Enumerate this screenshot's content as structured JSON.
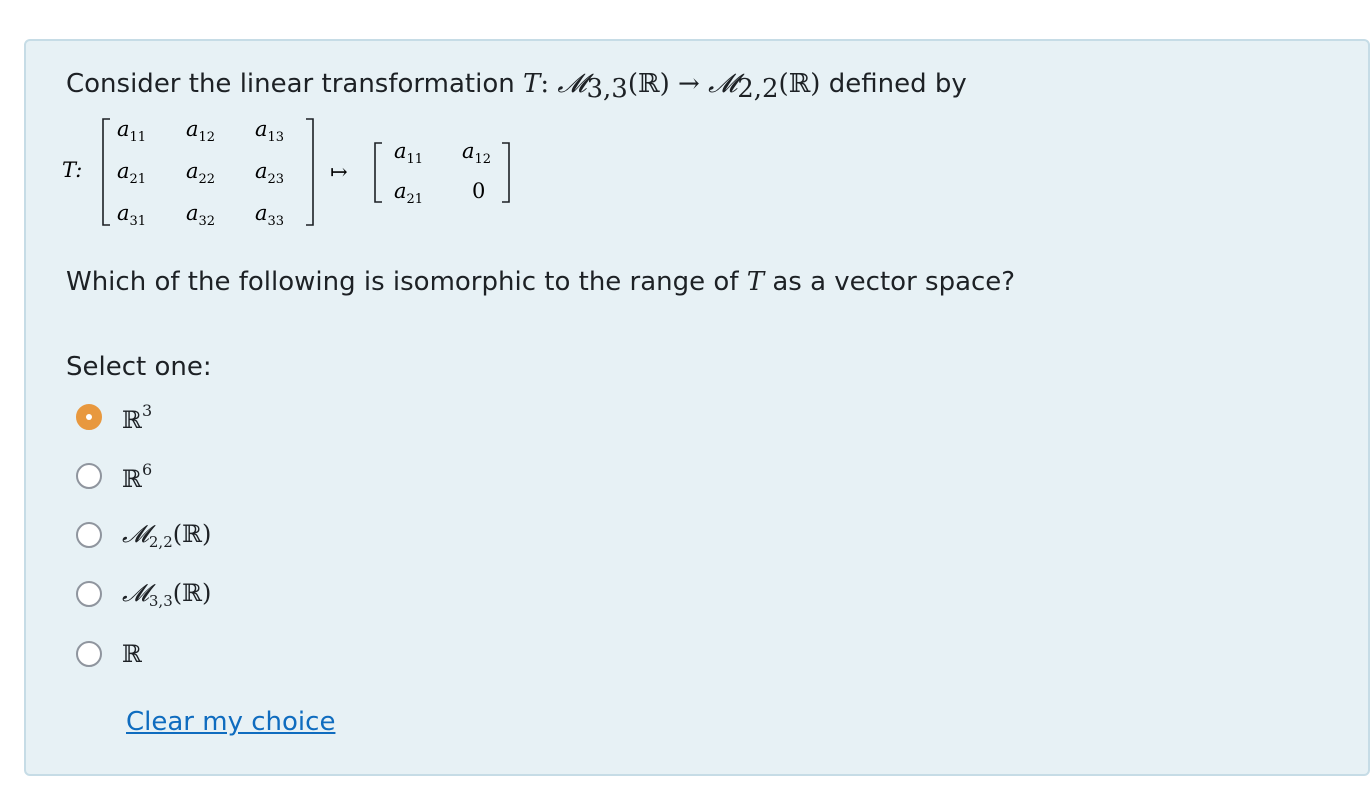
{
  "question": {
    "intro_prefix": "Consider the linear transformation ",
    "T_symbol": "T",
    "colon": ":",
    "domain_space": "𝓜",
    "domain_sub": "3,3",
    "domain_field": "(ℝ)",
    "arrow": "→",
    "codomain_space": "𝓜",
    "codomain_sub": "2,2",
    "codomain_field": "(ℝ)",
    "intro_suffix": " defined by",
    "mapping": {
      "T_label": "T:",
      "maps_to": "↦",
      "input_matrix": [
        [
          "a11",
          "a12",
          "a13"
        ],
        [
          "a21",
          "a22",
          "a23"
        ],
        [
          "a31",
          "a32",
          "a33"
        ]
      ],
      "output_matrix": [
        [
          "a11",
          "a12"
        ],
        [
          "a21",
          "0"
        ]
      ]
    },
    "prompt_prefix": "Which of the following is isomorphic to the range of ",
    "prompt_T": "T",
    "prompt_suffix": " as a vector space?"
  },
  "select_label": "Select one:",
  "options": [
    {
      "base": "ℝ",
      "sup": "3",
      "sub": "",
      "tail": "",
      "checked": true
    },
    {
      "base": "ℝ",
      "sup": "6",
      "sub": "",
      "tail": "",
      "checked": false
    },
    {
      "base": "𝓜",
      "sup": "",
      "sub": "2,2",
      "tail": "(ℝ)",
      "checked": false
    },
    {
      "base": "𝓜",
      "sup": "",
      "sub": "3,3",
      "tail": "(ℝ)",
      "checked": false
    },
    {
      "base": "ℝ",
      "sup": "",
      "sub": "",
      "tail": "",
      "checked": false
    }
  ],
  "clear_choice": "Clear my choice",
  "colors": {
    "card_bg": "#e7f1f5",
    "card_border": "#c6dce6",
    "radio_checked": "#e8983e",
    "link": "#0f6cbf"
  }
}
